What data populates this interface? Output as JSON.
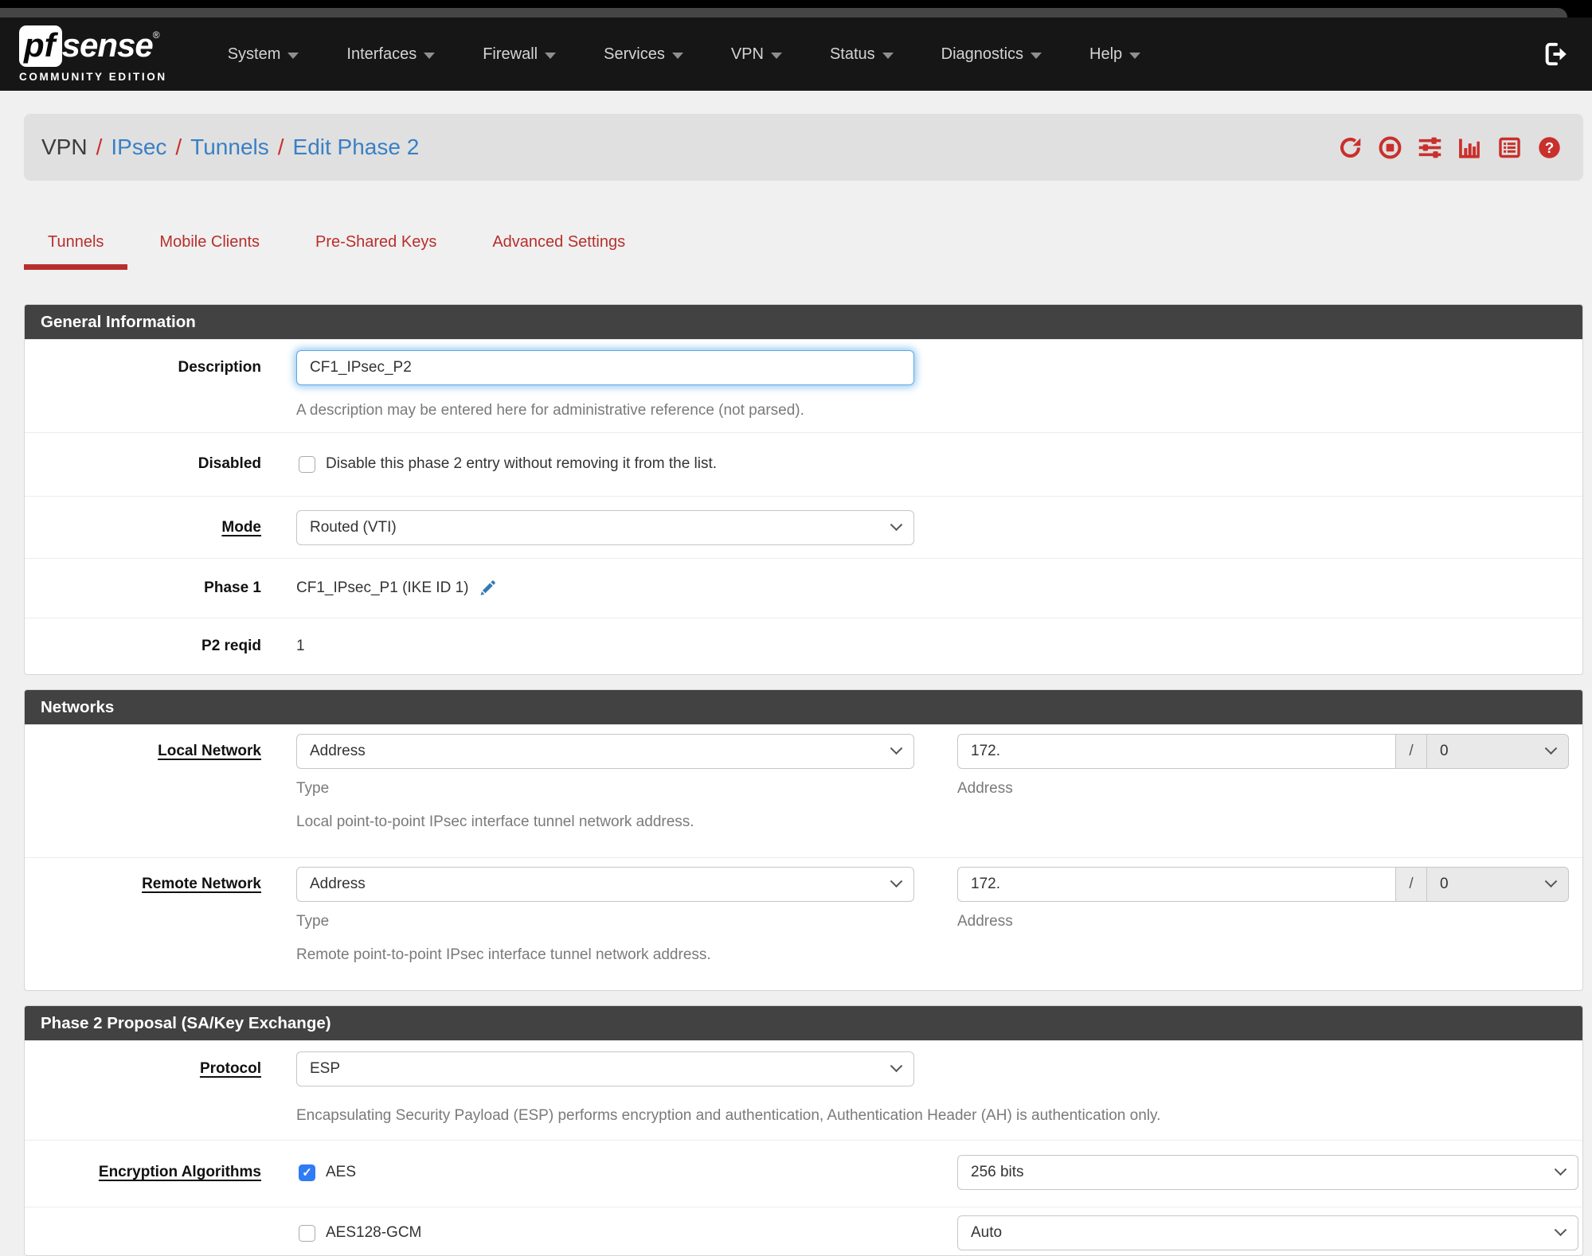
{
  "navbar": {
    "brand": {
      "pf": "pf",
      "sense": "sense",
      "trademark": "®",
      "edition": "COMMUNITY EDITION"
    },
    "items": [
      {
        "label": "System"
      },
      {
        "label": "Interfaces"
      },
      {
        "label": "Firewall"
      },
      {
        "label": "Services"
      },
      {
        "label": "VPN"
      },
      {
        "label": "Status"
      },
      {
        "label": "Diagnostics"
      },
      {
        "label": "Help"
      }
    ]
  },
  "breadcrumb": {
    "root": "VPN",
    "separator": "/",
    "links": [
      {
        "label": "IPsec"
      },
      {
        "label": "Tunnels"
      },
      {
        "label": "Edit Phase 2"
      }
    ],
    "action_icons": [
      "refresh-icon",
      "stop-icon",
      "sliders-icon",
      "bar-chart-icon",
      "list-icon",
      "help-icon"
    ],
    "navbar_right_icon": "sign-out-icon"
  },
  "tabs": [
    {
      "label": "Tunnels",
      "active": true
    },
    {
      "label": "Mobile Clients",
      "active": false
    },
    {
      "label": "Pre-Shared Keys",
      "active": false
    },
    {
      "label": "Advanced Settings",
      "active": false
    }
  ],
  "general": {
    "title": "General Information",
    "description": {
      "label": "Description",
      "value": "CF1_IPsec_P2",
      "help": "A description may be entered here for administrative reference (not parsed)."
    },
    "disabled": {
      "label": "Disabled",
      "checkbox_label": "Disable this phase 2 entry without removing it from the list.",
      "checked": false
    },
    "mode": {
      "label": "Mode",
      "value": "Routed (VTI)"
    },
    "phase1": {
      "label": "Phase 1",
      "value": "CF1_IPsec_P1 (IKE ID 1)",
      "edit_icon": "pencil-icon"
    },
    "p2reqid": {
      "label": "P2 reqid",
      "value": "1"
    }
  },
  "networks": {
    "title": "Networks",
    "local": {
      "label": "Local Network",
      "type_value": "Address",
      "type_sublabel": "Type",
      "address_value": "172.",
      "address_sublabel": "Address",
      "addon": "/",
      "prefix_value": "0",
      "help": "Local point-to-point IPsec interface tunnel network address."
    },
    "remote": {
      "label": "Remote Network",
      "type_value": "Address",
      "type_sublabel": "Type",
      "address_value": "172.",
      "address_sublabel": "Address",
      "addon": "/",
      "prefix_value": "0",
      "help": "Remote point-to-point IPsec interface tunnel network address."
    }
  },
  "proposal": {
    "title": "Phase 2 Proposal (SA/Key Exchange)",
    "protocol": {
      "label": "Protocol",
      "value": "ESP",
      "help": "Encapsulating Security Payload (ESP) performs encryption and authentication, Authentication Header (AH) is authentication only."
    },
    "encryption": {
      "label": "Encryption Algorithms",
      "rows": [
        {
          "name": "AES",
          "checked": true,
          "check_glyph": "✓",
          "keylen": "256 bits"
        },
        {
          "name": "AES128-GCM",
          "checked": false,
          "check_glyph": "",
          "keylen": "Auto"
        }
      ]
    }
  },
  "colors": {
    "accent_red": "#c9302c",
    "tab_red": "#b72f2c",
    "link_blue": "#3a80c4",
    "pencil_blue": "#337ab7",
    "checkbox_blue": "#2f7cf6",
    "panel_header_bg": "#424242"
  }
}
